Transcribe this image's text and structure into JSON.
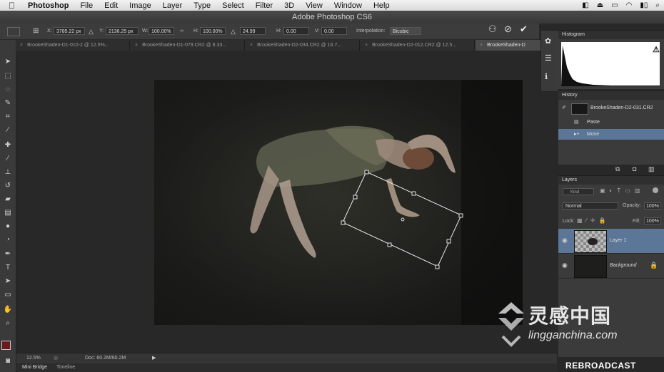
{
  "menubar": {
    "apple": "",
    "items": [
      "Photoshop",
      "File",
      "Edit",
      "Image",
      "Layer",
      "Type",
      "Select",
      "Filter",
      "3D",
      "View",
      "Window",
      "Help"
    ]
  },
  "window": {
    "title": "Adobe Photoshop CS6"
  },
  "options": {
    "x_value": "3785.22 px",
    "y_value": "2136.25 px",
    "w_value": "100.00%",
    "h_value": "100.00%",
    "angle_value": "24.99",
    "h_skew_value": "0.00",
    "v_skew_value": "0.00",
    "interpolation_label": "Interpolation:",
    "interpolation_value": "Bicubic",
    "x_label": "X:",
    "y_label": "Y:",
    "w_label": "W:",
    "h_label": "H:",
    "hs_label": "H:",
    "vs_label": "V:"
  },
  "tabs": [
    {
      "label": "BrookeShaden-D1-010-2 @ 12.5%..."
    },
    {
      "label": "BrookeShaden-D1-079.CR2 @ 8.33..."
    },
    {
      "label": "BrookeShaden-D2-034.CR2 @ 16.7..."
    },
    {
      "label": "BrookeShaden-D2-012.CR2 @ 12.5..."
    },
    {
      "label": "BrookeShaden-D"
    }
  ],
  "status": {
    "zoom": "12.5%",
    "doc": "Doc: 60.2M/60.2M"
  },
  "bottom_tabs": [
    "Mini Bridge",
    "Timeline"
  ],
  "panels": {
    "histogram": {
      "title": "Histogram"
    },
    "history": {
      "title": "History",
      "snapshot_label": "BrookeShaden-D2-031.CR2",
      "items": [
        {
          "label": "Paste"
        },
        {
          "label": "Move"
        }
      ]
    },
    "layers": {
      "title": "Layers",
      "kind_label": "Kind",
      "blend_mode": "Normal",
      "opacity_label": "Opacity:",
      "opacity_value": "100%",
      "lock_label": "Lock:",
      "fill_label": "Fill:",
      "fill_value": "100%",
      "layers": [
        {
          "name": "Layer 1"
        },
        {
          "name": "Background"
        }
      ]
    }
  },
  "watermark": {
    "brand_cn": "灵感中国",
    "brand_en": "lingganchina.com"
  },
  "rebroadcast": "REBROADCAST"
}
